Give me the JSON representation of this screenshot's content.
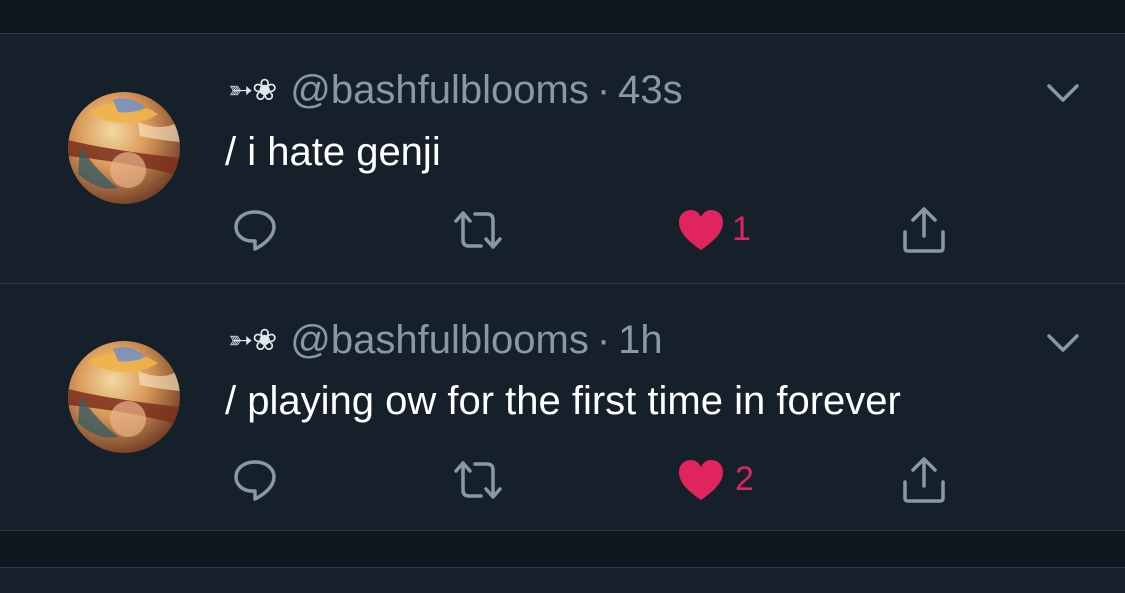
{
  "colors": {
    "background": "#15202b",
    "divider": "#2f3b49",
    "secondary_text": "#8899a6",
    "like_red": "#e0245e"
  },
  "tweets": [
    {
      "display_name": "➳❀",
      "handle": "@bashfulblooms",
      "separator": "·",
      "time": "43s",
      "text": "/ i hate genji",
      "likes": "1",
      "liked": true,
      "icons": [
        "reply-icon",
        "retweet-icon",
        "heart-icon",
        "share-icon",
        "chevron-down-icon"
      ]
    },
    {
      "display_name": "➳❀",
      "handle": "@bashfulblooms",
      "separator": "·",
      "time": "1h",
      "text": "/ playing ow for the first time in forever",
      "likes": "2",
      "liked": true,
      "icons": [
        "reply-icon",
        "retweet-icon",
        "heart-icon",
        "share-icon",
        "chevron-down-icon"
      ]
    }
  ]
}
